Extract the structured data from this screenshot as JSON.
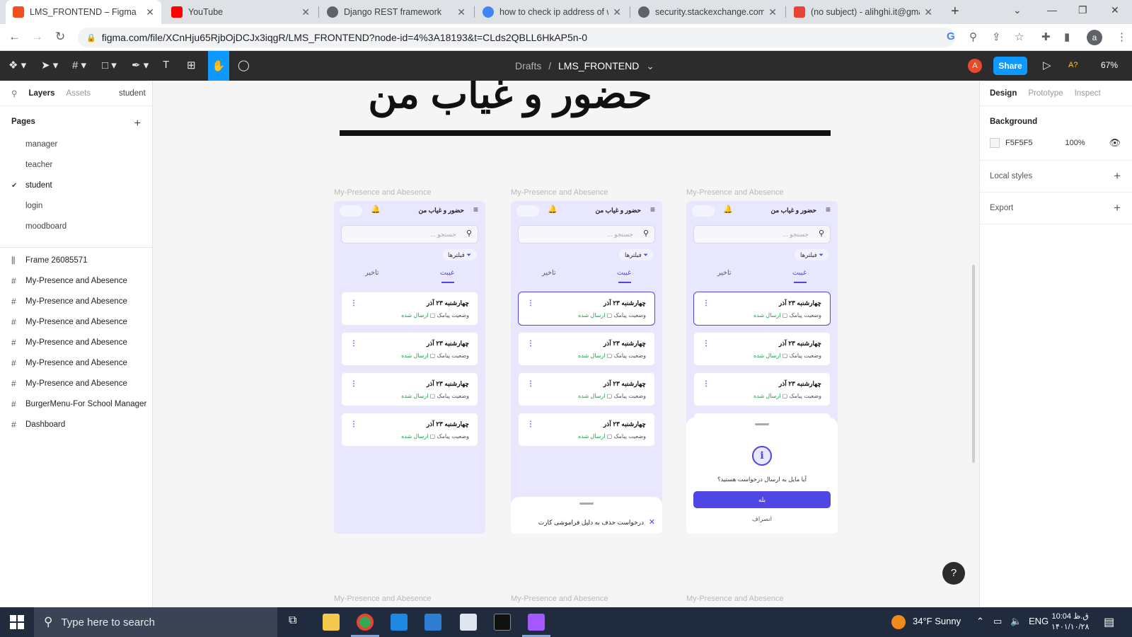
{
  "browser": {
    "tabs": [
      {
        "title": "LMS_FRONTEND – Figma",
        "icon": "figma-icon",
        "color": "#f24e1e"
      },
      {
        "title": "YouTube",
        "icon": "youtube-icon",
        "color": "#ff0000"
      },
      {
        "title": "Django REST framework",
        "icon": "globe-icon",
        "color": "#5f6368"
      },
      {
        "title": "how to check ip address of w",
        "icon": "google-icon",
        "color": "#4285f4"
      },
      {
        "title": "security.stackexchange.com",
        "icon": "globe-icon",
        "color": "#5f6368"
      },
      {
        "title": "(no subject) - alihghi.it@gma",
        "icon": "gmail-icon",
        "color": "#ea4335"
      }
    ],
    "url": "figma.com/file/XCnHju65RjbOjDCJx3iqgR/LMS_FRONTEND?node-id=4%3A18193&t=CLds2QBLL6HkAP5n-0",
    "profile_initial": "a"
  },
  "figma": {
    "breadcrumb_parent": "Drafts",
    "breadcrumb_sep": "/",
    "file_name": "LMS_FRONTEND",
    "user_initial": "A",
    "share_label": "Share",
    "zoom": "67%",
    "left_tabs": {
      "layers": "Layers",
      "assets": "Assets",
      "page": "student"
    },
    "pages_header": "Pages",
    "pages": [
      "manager",
      "teacher",
      "student",
      "login",
      "moodboard"
    ],
    "layers": [
      {
        "glyph": "⫼",
        "name": "Frame 26085571"
      },
      {
        "glyph": "#",
        "name": "My-Presence and Abesence"
      },
      {
        "glyph": "#",
        "name": "My-Presence and Abesence"
      },
      {
        "glyph": "#",
        "name": "My-Presence and Abesence"
      },
      {
        "glyph": "#",
        "name": "My-Presence and Abesence"
      },
      {
        "glyph": "#",
        "name": "My-Presence and Abesence"
      },
      {
        "glyph": "#",
        "name": "My-Presence and Abesence"
      },
      {
        "glyph": "#",
        "name": "BurgerMenu-For School Manager"
      },
      {
        "glyph": "#",
        "name": "Dashboard"
      }
    ],
    "right_tabs": {
      "design": "Design",
      "prototype": "Prototype",
      "inspect": "Inspect"
    },
    "background_label": "Background",
    "background_hex": "F5F5F5",
    "background_opacity": "100%",
    "local_styles": "Local styles",
    "export": "Export",
    "help": "?"
  },
  "canvas": {
    "big_title": "حضور و غیاب من",
    "frame_label": "My-Presence and Abesence",
    "phone_title": "حضور و غیاب من",
    "search_placeholder": "جستجو ...",
    "filters": "فیلترها",
    "tab_absence": "غیبت",
    "tab_delay": "تاخیر",
    "card_date": "چهارشنبه ۲۳ آذر",
    "card_status_label": "وضعیت پیامک",
    "card_status_value": "ارسال شده",
    "sheet_text": "درخواست حذف به دلیل فراموشی کارت",
    "dialog_question": "آیا مایل به ارسال درخواست هستید؟",
    "dialog_yes": "بله",
    "dialog_cancel": "انصراف"
  },
  "taskbar": {
    "search_placeholder": "Type here to search",
    "weather": "34°F  Sunny",
    "language": "ENG",
    "time": "ق.ظ 10:04",
    "date": "۱۴۰۱/۱۰/۲۸"
  },
  "colors": {
    "accent": "#4f46e5",
    "figma_blue": "#0d99ff",
    "phone_bg": "#e8e7fd",
    "sent_green": "#1aa34a"
  }
}
